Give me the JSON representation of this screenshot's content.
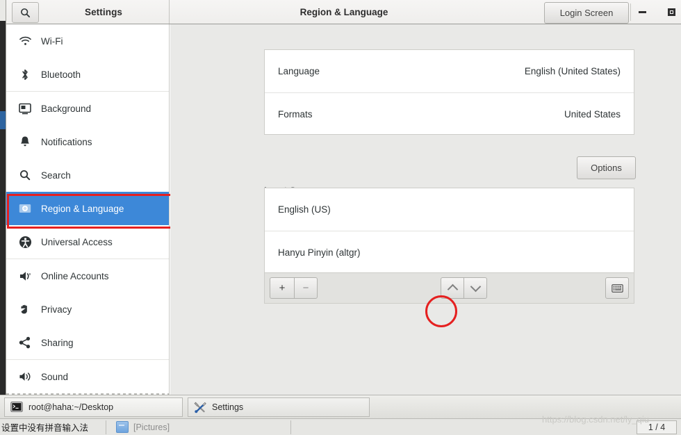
{
  "window": {
    "app_title": "Settings",
    "page_title": "Region & Language",
    "login_screen_label": "Login Screen",
    "search_icon": "search-icon",
    "minimize_label": "Minimize",
    "maximize_label": "Maximize"
  },
  "sidebar": {
    "items": [
      {
        "label": "Wi-Fi",
        "icon": "wifi-icon",
        "selected": false
      },
      {
        "label": "Bluetooth",
        "icon": "bluetooth-icon",
        "selected": false
      },
      {
        "label": "Background",
        "icon": "background-icon",
        "selected": false
      },
      {
        "label": "Notifications",
        "icon": "bell-icon",
        "selected": false
      },
      {
        "label": "Search",
        "icon": "search-icon",
        "selected": false
      },
      {
        "label": "Region & Language",
        "icon": "region-language-icon",
        "selected": true
      },
      {
        "label": "Universal Access",
        "icon": "universal-access-icon",
        "selected": false
      },
      {
        "label": "Online Accounts",
        "icon": "online-accounts-icon",
        "selected": false
      },
      {
        "label": "Privacy",
        "icon": "hand-icon",
        "selected": false
      },
      {
        "label": "Sharing",
        "icon": "share-icon",
        "selected": false
      },
      {
        "label": "Sound",
        "icon": "speaker-icon",
        "selected": false
      }
    ]
  },
  "main": {
    "language_card": {
      "rows": [
        {
          "key": "Language",
          "value": "English (United States)"
        },
        {
          "key": "Formats",
          "value": "United States"
        }
      ]
    },
    "input_sources": {
      "section_label": "Input Sources",
      "options_label": "Options",
      "sources": [
        {
          "label": "English (US)"
        },
        {
          "label": "Hanyu Pinyin (altgr)"
        }
      ],
      "toolbar": {
        "add_label": "+",
        "remove_label": "−",
        "move_up_label": "Move up",
        "move_down_label": "Move down",
        "keyboard_label": "Show keyboard layout"
      }
    }
  },
  "taskbar": {
    "tasks": [
      {
        "label": "root@haha:~/Desktop",
        "icon": "terminal-icon"
      },
      {
        "label": "Settings",
        "icon": "tools-icon"
      }
    ]
  },
  "bottom_bar": {
    "status_text": "设置中没有拼音输入法",
    "folder_label": "[Pictures]",
    "pager": "1 / 4",
    "watermark": "https://blog.csdn.net/ly_qiu"
  },
  "colors": {
    "selection_blue": "#3d88d8",
    "highlight_red": "#e52020",
    "header_bg": "#f2f1f0",
    "content_bg": "#e9e9e7"
  }
}
